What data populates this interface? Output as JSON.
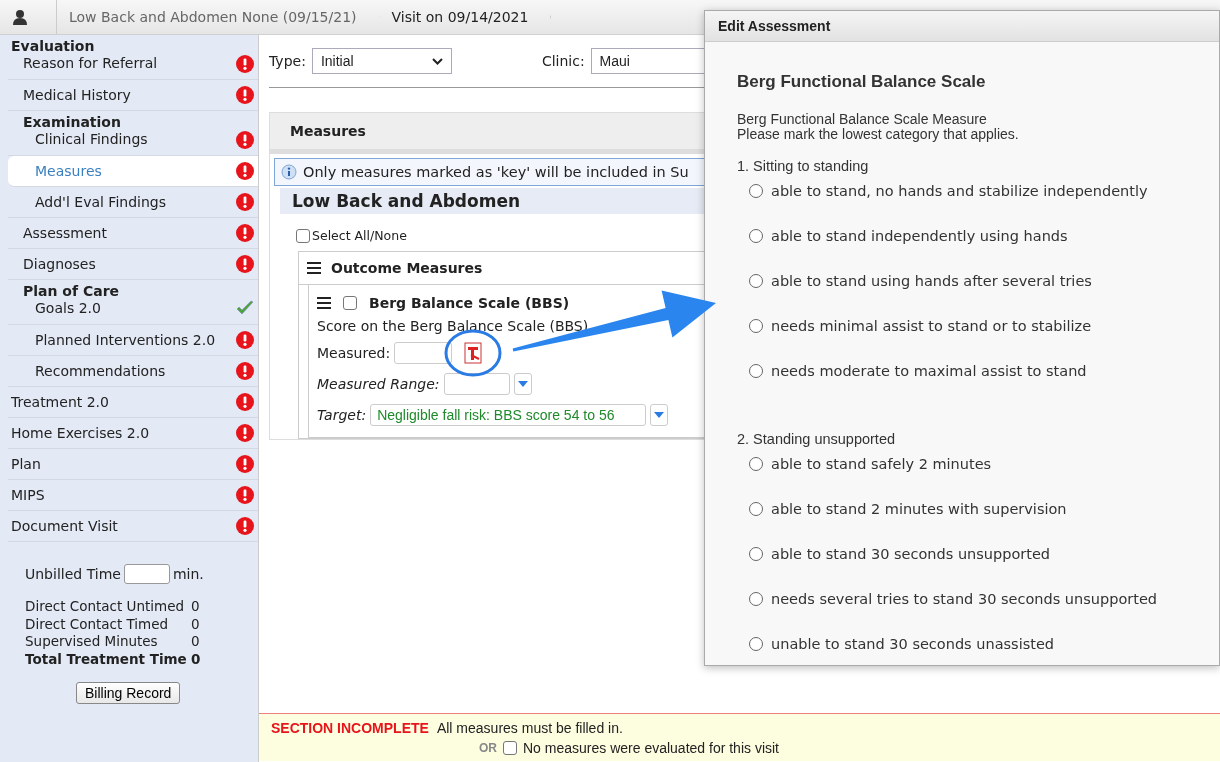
{
  "breadcrumbs": [
    {
      "label": "Low Back and Abdomen None (09/15/21)",
      "selected": false
    },
    {
      "label": "Visit on 09/14/2021",
      "selected": true
    }
  ],
  "sidebar": {
    "items": [
      {
        "label": "Evaluation",
        "children": [
          {
            "label": "Reason for Referral",
            "complete": false,
            "selected": false
          },
          {
            "label": "Medical History",
            "complete": false,
            "selected": false
          },
          {
            "label": "Examination",
            "children": [
              {
                "label": "Clinical Findings",
                "complete": false,
                "selected": false
              },
              {
                "label": "Measures",
                "complete": false,
                "selected": true
              },
              {
                "label": "Add'l Eval Findings",
                "complete": false,
                "selected": false
              }
            ]
          },
          {
            "label": "Assessment",
            "complete": false,
            "selected": false
          },
          {
            "label": "Diagnoses",
            "complete": false,
            "selected": false
          },
          {
            "label": "Plan of Care",
            "children": [
              {
                "label": "Goals 2.0",
                "complete": true,
                "selected": false
              },
              {
                "label": "Planned Interventions 2.0",
                "complete": false,
                "selected": false
              },
              {
                "label": "Recommendations",
                "complete": false,
                "selected": false
              }
            ]
          }
        ]
      },
      {
        "label": "Treatment 2.0",
        "complete": false,
        "selected": false
      },
      {
        "label": "Home Exercises 2.0",
        "complete": false,
        "selected": false
      },
      {
        "label": "Plan",
        "complete": false,
        "selected": false
      },
      {
        "label": "MIPS",
        "complete": false,
        "selected": false
      },
      {
        "label": "Document Visit",
        "complete": false,
        "selected": false
      }
    ],
    "unbilled_time": {
      "label": "Unbilled Time",
      "unit": "min."
    },
    "time_summary": [
      {
        "label": "Direct Contact Untimed",
        "value": "0",
        "kind": "normal"
      },
      {
        "label": "Direct Contact Timed",
        "value": "0",
        "kind": "normal"
      },
      {
        "label": "Supervised Minutes",
        "value": "0",
        "kind": "normal"
      },
      {
        "label": "Total Treatment Time",
        "value": "0",
        "kind": "total"
      }
    ],
    "billing_button": "Billing Record"
  },
  "form": {
    "type": {
      "label": "Type:",
      "value": "Initial"
    },
    "clinic": {
      "label": "Clinic:",
      "value": "Maui"
    }
  },
  "measures_panel": {
    "title": "Measures",
    "info": "Only measures marked as 'key' will be included in Su",
    "region": "Low Back and Abdomen",
    "select_all": {
      "label": "Select All/None",
      "checked": false
    },
    "group": {
      "title": "Outcome Measures",
      "measure": {
        "title": "Berg Balance Scale (BBS)",
        "checked": false,
        "description": "Score on the Berg Balance Scale (BBS)",
        "measured_label": "Measured:",
        "range_label": "Measured Range:",
        "target_label": "Target:",
        "target_value": "Negligible fall risk: BBS score 54 to 56"
      }
    }
  },
  "alert": {
    "title": "SECTION INCOMPLETE",
    "message": "All measures must be filled in.",
    "or": "OR",
    "option": {
      "label": "No measures were evaluated for this visit",
      "checked": false
    }
  },
  "dialog": {
    "title": "Edit Assessment",
    "heading": "Berg Functional Balance Scale",
    "description": [
      "Berg Functional Balance Scale Measure",
      "Please mark the lowest category that applies."
    ],
    "questions": [
      {
        "title": "1. Sitting to standing",
        "options": [
          {
            "label": "able to stand, no hands and stabilize independently",
            "selected": false
          },
          {
            "label": "able to stand independently using hands",
            "selected": false
          },
          {
            "label": "able to stand using hands after several tries",
            "selected": false
          },
          {
            "label": "needs minimal assist to stand or to stabilize",
            "selected": false
          },
          {
            "label": "needs moderate to maximal assist to stand",
            "selected": false
          }
        ]
      },
      {
        "title": "2. Standing unsupported",
        "options": [
          {
            "label": "able to stand safely 2 minutes",
            "selected": false
          },
          {
            "label": "able to stand 2 minutes with supervision",
            "selected": false
          },
          {
            "label": "able to stand 30 seconds unsupported",
            "selected": false
          },
          {
            "label": "needs several tries to stand 30 seconds unsupported",
            "selected": false
          },
          {
            "label": "unable to stand 30 seconds unassisted",
            "selected": false
          }
        ]
      }
    ]
  }
}
